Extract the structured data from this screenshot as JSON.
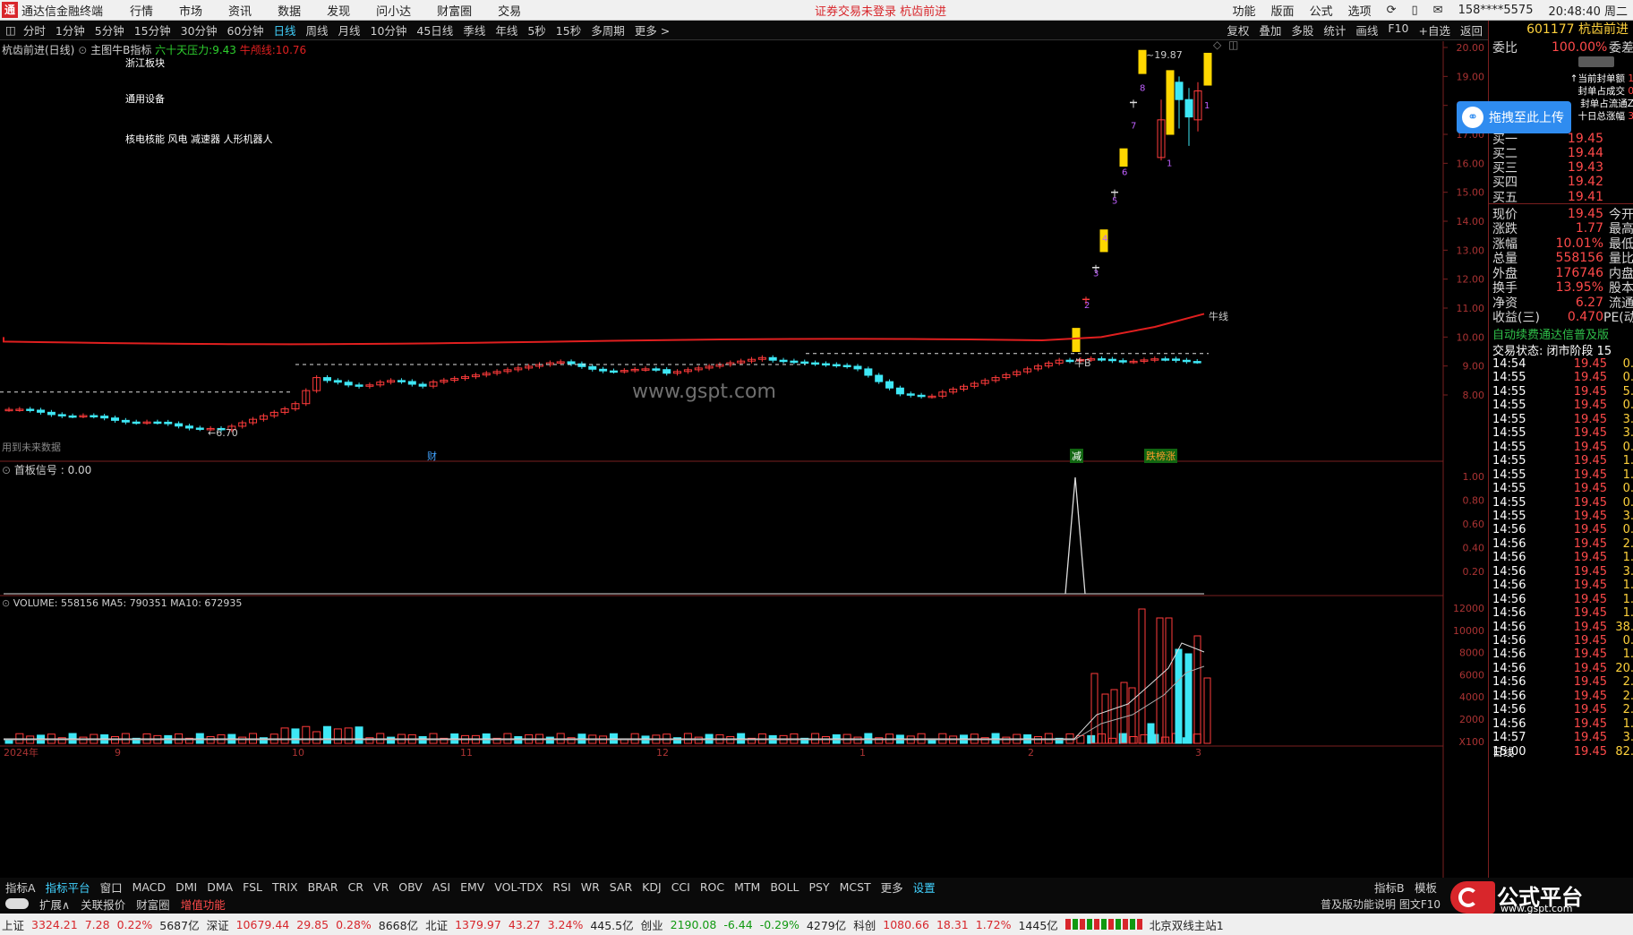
{
  "titlebar": {
    "app_name": "通达信金融终端",
    "menus": [
      "行情",
      "市场",
      "资讯",
      "数据",
      "发现",
      "问小达",
      "财富圈",
      "交易"
    ],
    "warning": "证券交易未登录   杭齿前进",
    "right_items": [
      "功能",
      "版面",
      "公式",
      "选项"
    ],
    "account": "158****5575",
    "clock": "20:48:40 周二"
  },
  "periodbar": {
    "periods": [
      "分时",
      "1分钟",
      "5分钟",
      "15分钟",
      "30分钟",
      "60分钟",
      "日线",
      "周线",
      "月线",
      "10分钟",
      "45日线",
      "季线",
      "年线",
      "5秒",
      "15秒",
      "多周期",
      "更多 >"
    ],
    "active": "日线",
    "right": [
      "复权",
      "叠加",
      "多股",
      "统计",
      "画线",
      "F10",
      "+自选",
      "返回"
    ]
  },
  "main_panel": {
    "stock_title": "杭齿前进(日线)",
    "indicator_name": "主图牛B指标",
    "pressure_label": "六十天压力:",
    "pressure_value": "9.43",
    "niu_label": "牛颅线:",
    "niu_value": "10.76",
    "note_sector": "浙江板块",
    "note_industry": "通用设备",
    "note_concepts": "核电核能 风电 减速器 人形机器人",
    "future_data_note": "用到未来数据",
    "watermark": "www.gspt.com",
    "low_label": "6.70",
    "high_label": "19.87",
    "niu_line_label": "牛线",
    "niu_b_label": "牛B",
    "markers": [
      "财",
      "减",
      "跌榜涨"
    ],
    "y_axis": [
      "20.00",
      "19.00",
      "18.00",
      "17.00",
      "16.00",
      "15.00",
      "14.00",
      "13.00",
      "12.00",
      "11.00",
      "10.00",
      "9.00",
      "8.00"
    ],
    "x_axis": [
      "2024年",
      "9",
      "10",
      "11",
      "12",
      "1",
      "2",
      "3"
    ],
    "limit_counts": [
      "2",
      "3",
      "4",
      "5",
      "6",
      "7",
      "8",
      "1",
      "1"
    ]
  },
  "signal_panel": {
    "title": "首板信号 : 0.00",
    "y_axis": [
      "1.00",
      "0.80",
      "0.60",
      "0.40",
      "0.20"
    ]
  },
  "volume_panel": {
    "title": "VOLUME: 558156  MA5: 790351  MA10: 672935",
    "y_axis": [
      "12000",
      "10000",
      "8000",
      "6000",
      "4000",
      "2000",
      "X100"
    ]
  },
  "quote": {
    "code_name": "601177 杭齿前进",
    "weibi_label": "委比",
    "weibi_value": "100.00%",
    "weicha_label": "委差",
    "tips": [
      "↑当前封单额",
      "封单占成交",
      "封单占流通Z",
      "十日总涨幅"
    ],
    "tip_vals": [
      "1",
      "0",
      "",
      "3"
    ],
    "bids": [
      {
        "label": "买一",
        "price": "19.45"
      },
      {
        "label": "买二",
        "price": "19.44"
      },
      {
        "label": "买三",
        "price": "19.43"
      },
      {
        "label": "买四",
        "price": "19.42"
      },
      {
        "label": "买五",
        "price": "19.41"
      }
    ],
    "stats": [
      {
        "label": "现价",
        "value": "19.45",
        "right": "今开"
      },
      {
        "label": "涨跌",
        "value": "1.77",
        "right": "最高"
      },
      {
        "label": "涨幅",
        "value": "10.01%",
        "right": "最低"
      },
      {
        "label": "总量",
        "value": "558156",
        "right": "量比"
      },
      {
        "label": "外盘",
        "value": "176746",
        "right": "内盘"
      },
      {
        "label": "换手",
        "value": "13.95%",
        "right": "股本"
      },
      {
        "label": "净资",
        "value": "6.27",
        "right": "流通"
      },
      {
        "label": "收益(三)",
        "value": "0.470",
        "right": "PE(动"
      }
    ],
    "auto_renew": "自动续费通达信普及版",
    "trade_state": "交易状态: 闭市阶段 15",
    "ticks": [
      {
        "t": "14:54",
        "p": "19.45",
        "v": "0."
      },
      {
        "t": "14:55",
        "p": "19.45",
        "v": "0."
      },
      {
        "t": "14:55",
        "p": "19.45",
        "v": "5."
      },
      {
        "t": "14:55",
        "p": "19.45",
        "v": "0."
      },
      {
        "t": "14:55",
        "p": "19.45",
        "v": "3."
      },
      {
        "t": "14:55",
        "p": "19.45",
        "v": "3."
      },
      {
        "t": "14:55",
        "p": "19.45",
        "v": "0."
      },
      {
        "t": "14:55",
        "p": "19.45",
        "v": "1."
      },
      {
        "t": "14:55",
        "p": "19.45",
        "v": "1."
      },
      {
        "t": "14:55",
        "p": "19.45",
        "v": "0."
      },
      {
        "t": "14:55",
        "p": "19.45",
        "v": "0."
      },
      {
        "t": "14:55",
        "p": "19.45",
        "v": "3."
      },
      {
        "t": "14:56",
        "p": "19.45",
        "v": "0."
      },
      {
        "t": "14:56",
        "p": "19.45",
        "v": "2."
      },
      {
        "t": "14:56",
        "p": "19.45",
        "v": "1."
      },
      {
        "t": "14:56",
        "p": "19.45",
        "v": "3."
      },
      {
        "t": "14:56",
        "p": "19.45",
        "v": "1."
      },
      {
        "t": "14:56",
        "p": "19.45",
        "v": "1."
      },
      {
        "t": "14:56",
        "p": "19.45",
        "v": "1."
      },
      {
        "t": "14:56",
        "p": "19.45",
        "v": "38."
      },
      {
        "t": "14:56",
        "p": "19.45",
        "v": "0."
      },
      {
        "t": "14:56",
        "p": "19.45",
        "v": "1."
      },
      {
        "t": "14:56",
        "p": "19.45",
        "v": "20."
      },
      {
        "t": "14:56",
        "p": "19.45",
        "v": "2."
      },
      {
        "t": "14:56",
        "p": "19.45",
        "v": "2."
      },
      {
        "t": "14:56",
        "p": "19.45",
        "v": "2."
      },
      {
        "t": "14:56",
        "p": "19.45",
        "v": "1."
      },
      {
        "t": "14:57",
        "p": "19.45",
        "v": "3."
      },
      {
        "t": "15:00",
        "p": "19.45",
        "v": "82."
      }
    ],
    "tab": "日线"
  },
  "indicator_bar": {
    "items": [
      "指标A",
      "指标平台",
      "窗口",
      "MACD",
      "DMI",
      "DMA",
      "FSL",
      "TRIX",
      "BRAR",
      "CR",
      "VR",
      "OBV",
      "ASI",
      "EMV",
      "VOL-TDX",
      "RSI",
      "WR",
      "SAR",
      "KDJ",
      "CCI",
      "ROC",
      "MTM",
      "BOLL",
      "PSY",
      "MCST",
      "更多",
      "设置"
    ],
    "right": [
      "指标B",
      "模板"
    ]
  },
  "ext_bar": {
    "items": [
      "扩展∧",
      "关联报价",
      "财富圈",
      "增值功能"
    ],
    "right": "普及版功能说明  图文F10"
  },
  "statusbar": {
    "sh_label": "上证",
    "sh": "3324.21",
    "sh_chg": "7.28",
    "sh_pct": "0.22%",
    "sh_amt": "5687亿",
    "sz_label": "深证",
    "sz": "10679.44",
    "sz_chg": "29.85",
    "sz_pct": "0.28%",
    "sz_amt": "8668亿",
    "bz_label": "北证",
    "bz": "1379.97",
    "bz_chg": "43.27",
    "bz_pct": "3.24%",
    "bz_amt": "445.5亿",
    "cy_label": "创业",
    "cy": "2190.08",
    "cy_chg": "-6.44",
    "cy_pct": "-0.29%",
    "cy_amt": "4279亿",
    "kc_label": "科创",
    "kc": "1080.66",
    "kc_chg": "18.31",
    "kc_pct": "1.72%",
    "kc_amt": "1445亿",
    "server": "北京双线主站1"
  },
  "upload_button": "拖拽至此上传",
  "brand": {
    "name": "公式平台",
    "url": "www.gspt.com"
  },
  "colors": {
    "up": "#ff3b3b",
    "down": "#3ee7f5",
    "limit": "#ffd700",
    "ma": "#e01f1f",
    "bg": "#000000"
  }
}
